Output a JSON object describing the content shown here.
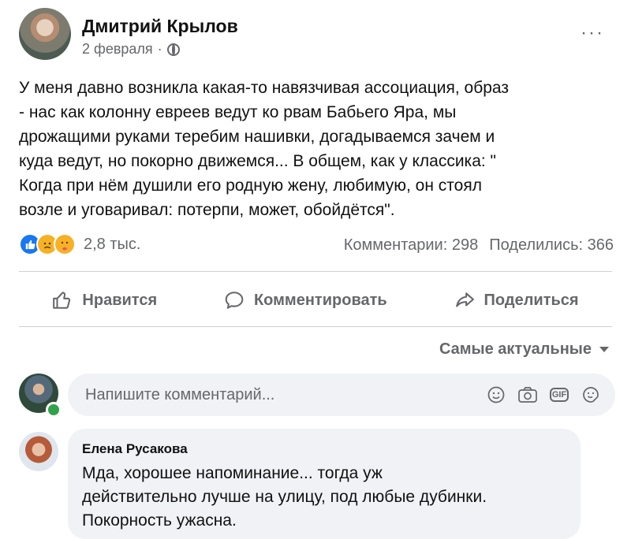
{
  "post": {
    "author": "Дмитрий Крылов",
    "date": "2 февраля",
    "separator": "·",
    "more_label": "···",
    "text": "У меня давно возникла какая-то навязчивая ассоциация, образ\n- нас как колонну евреев ведут ко рвам Бабьего Яра, мы\nдрожащими руками теребим нашивки, догадываемся зачем и\nкуда ведут, но покорно движемся... В общем, как у классика: \"\nКогда при нём душили его родную жену, любимую, он стоял\nвозле и уговаривал: потерпи, может, обойдётся\"."
  },
  "reactions": {
    "count": "2,8 тыс.",
    "types": [
      "like-icon",
      "sad-icon",
      "care-icon"
    ]
  },
  "stats": {
    "comments": "Комментарии: 298",
    "shares": "Поделились: 366"
  },
  "actions": {
    "like": "Нравится",
    "comment": "Комментировать",
    "share": "Поделиться"
  },
  "sort": {
    "label": "Самые актуальные"
  },
  "composer": {
    "placeholder": "Напишите комментарий...",
    "icons": [
      "emoji-icon",
      "camera-icon",
      "gif-icon",
      "sticker-icon"
    ],
    "gif_label": "GIF"
  },
  "comments": [
    {
      "author": "Елена Русакова",
      "text": "Мда, хорошее напоминание... тогда уж\nдействительно лучше на улицу, под любые дубинки.\nПокорность ужасна."
    }
  ],
  "colors": {
    "text": "#1c1e21",
    "secondary": "#65676b",
    "like_blue": "#1877f2",
    "bubble": "#f0f2f5",
    "online": "#31a24c"
  }
}
